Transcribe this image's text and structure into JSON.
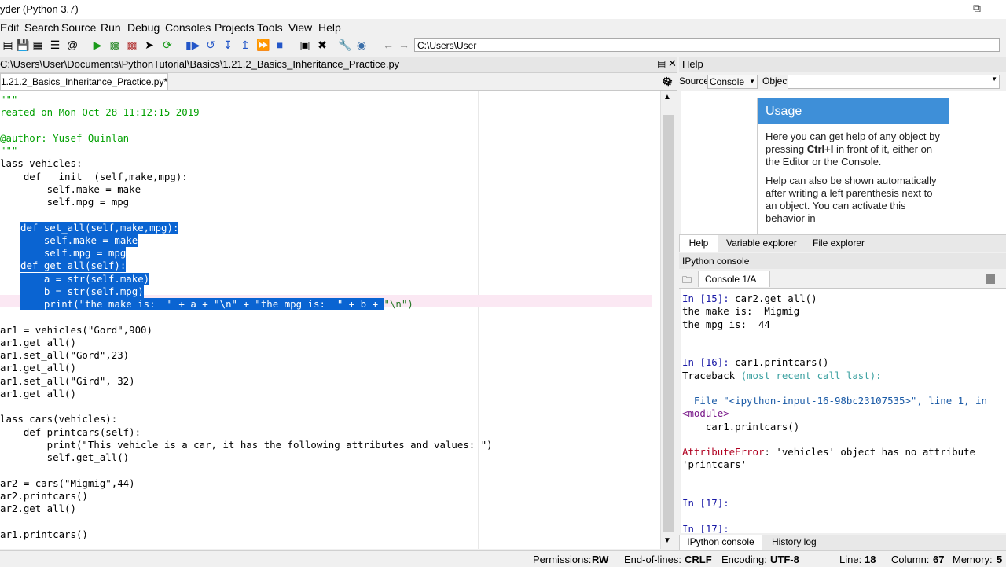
{
  "window": {
    "title": "yder (Python 3.7)"
  },
  "menu": [
    "Edit",
    "Search",
    "Source",
    "Run",
    "Debug",
    "Consoles",
    "Projects",
    "Tools",
    "View",
    "Help"
  ],
  "toolbar": {
    "path": "C:\\Users\\User"
  },
  "editor": {
    "file_path": "C:\\Users\\User\\Documents\\PythonTutorial\\Basics\\1.21.2_Basics_Inheritance_Practice.py",
    "tab_label": "1.21.2_Basics_Inheritance_Practice.py*",
    "lines": [
      "\"\"\"",
      "reated on Mon Oct 28 11:12:15 2019",
      "",
      "@author: Yusef Quinlan",
      "\"\"\"",
      "lass vehicles:",
      "    def __init__(self,make,mpg):",
      "        self.make = make",
      "        self.mpg = mpg",
      "",
      "    def set_all(self,make,mpg):",
      "        self.make = make",
      "        self.mpg = mpg",
      "    def get_all(self):",
      "        a = str(self.make)",
      "        b = str(self.mpg)",
      "        print(\"the make is:  \" + a + \"\\n\" + \"the mpg is:  \" + b + \"\\n\")",
      "",
      "ar1 = vehicles(\"Gord\",900)",
      "ar1.get_all()",
      "ar1.set_all(\"Gord\",23)",
      "ar1.get_all()",
      "ar1.set_all(\"Gird\", 32)",
      "ar1.get_all()",
      "",
      "lass cars(vehicles):",
      "    def printcars(self):",
      "        print(\"This vehicle is a car, it has the following attributes and values: \")",
      "        self.get_all()",
      "",
      "ar2 = cars(\"Migmig\",44)",
      "ar2.printcars()",
      "ar2.get_all()",
      "",
      "ar1.printcars()"
    ]
  },
  "help": {
    "title": "Help",
    "source_label": "Source",
    "source_value": "Console",
    "object_label": "Object",
    "usage_title": "Usage",
    "usage_p1a": "Here you can get help of any object by pressing ",
    "usage_p1b": "Ctrl+I",
    "usage_p1c": " in front of it, either on the Editor or the Console.",
    "usage_p2": "Help can also be shown automatically after writing a left parenthesis next to an object. You can activate this behavior in",
    "tabs": [
      "Help",
      "Variable explorer",
      "File explorer"
    ]
  },
  "console": {
    "pane_title": "IPython console",
    "tab_label": "Console 1/A",
    "lines": [
      {
        "t": "In [15]: car2.get_all()",
        "k": "prompt"
      },
      {
        "t": "the make is:  Migmig",
        "k": "out"
      },
      {
        "t": "the mpg is:  44",
        "k": "out"
      },
      {
        "t": "",
        "k": "out"
      },
      {
        "t": "",
        "k": "out"
      },
      {
        "t": "In [16]: car1.printcars()",
        "k": "prompt"
      },
      {
        "t": "Traceback (most recent call last):",
        "k": "tb"
      },
      {
        "t": "",
        "k": "out"
      },
      {
        "t": "  File \"<ipython-input-16-98bc23107535>\", line 1, in",
        "k": "file"
      },
      {
        "t": "<module>",
        "k": "mod"
      },
      {
        "t": "    car1.printcars()",
        "k": "out"
      },
      {
        "t": "",
        "k": "out"
      },
      {
        "t": "AttributeError: 'vehicles' object has no attribute",
        "k": "err"
      },
      {
        "t": "'printcars'",
        "k": "out"
      },
      {
        "t": "",
        "k": "out"
      },
      {
        "t": "",
        "k": "out"
      },
      {
        "t": "In [17]:",
        "k": "prompt"
      },
      {
        "t": "",
        "k": "out"
      },
      {
        "t": "In [17]:",
        "k": "prompt"
      }
    ],
    "bottom_tabs": [
      "IPython console",
      "History log"
    ]
  },
  "status": {
    "permissions_label": "Permissions:",
    "permissions": "RW",
    "eol_label": "End-of-lines:",
    "eol": "CRLF",
    "encoding_label": "Encoding:",
    "encoding": "UTF-8",
    "line_label": "Line:",
    "line": "18",
    "column_label": "Column:",
    "column": "67",
    "memory_label": "Memory:",
    "memory": "5"
  }
}
